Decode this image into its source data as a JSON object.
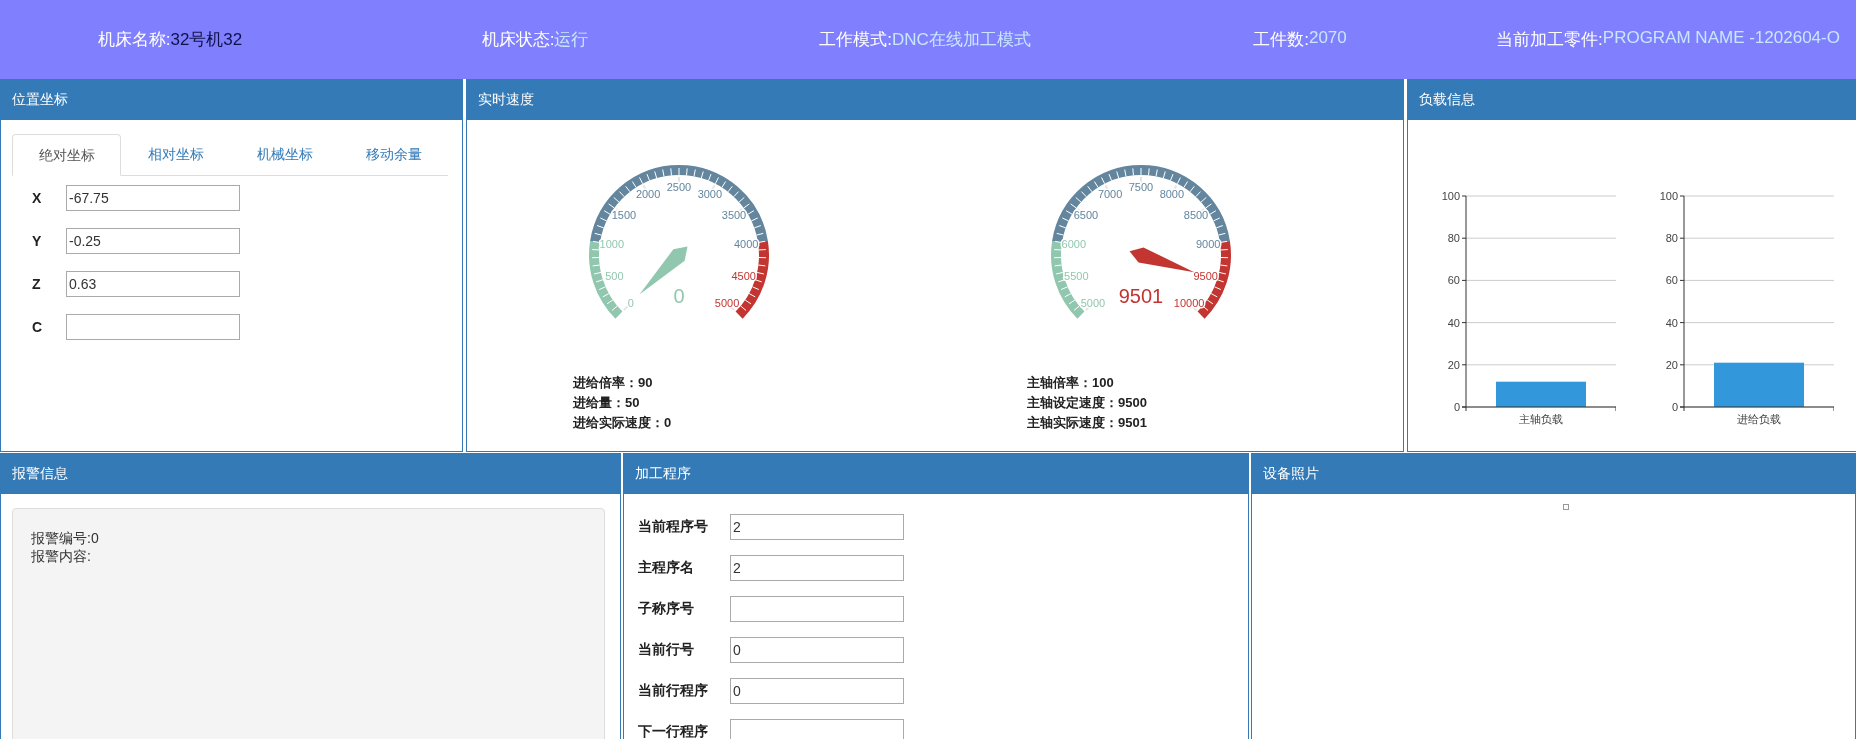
{
  "header": [
    {
      "label": "机床名称:",
      "value": "32号机32",
      "color": "#10104a"
    },
    {
      "label": "机床状态:",
      "value": "运行",
      "color": "#c8e6ff"
    },
    {
      "label": "工作模式:",
      "value": "DNC在线加工模式",
      "color": "#c8e6ff"
    },
    {
      "label": "工件数:",
      "value": "2070",
      "color": "#c8e6ff"
    },
    {
      "label": "当前加工零件:",
      "value": "PROGRAM NAME -1202604-O",
      "color": "#c8e6ff"
    }
  ],
  "position": {
    "title": "位置坐标",
    "tabs": [
      {
        "label": "绝对坐标",
        "selected": true
      },
      {
        "label": "相对坐标",
        "selected": false
      },
      {
        "label": "机械坐标",
        "selected": false
      },
      {
        "label": "移动余量",
        "selected": false
      }
    ],
    "axes": [
      {
        "label": "X",
        "value": "-67.75"
      },
      {
        "label": "Y",
        "value": "-0.25"
      },
      {
        "label": "Z",
        "value": "0.63"
      },
      {
        "label": "C"
      }
    ]
  },
  "speed": {
    "title": "实时速度",
    "gauges": [
      {
        "reading": "0",
        "tick_labels": [
          "0",
          "500",
          "1000",
          "1500",
          "2000",
          "2500",
          "3000",
          "3500",
          "4000",
          "4500",
          "5000"
        ],
        "stats": [
          "进给倍率：90",
          "进给量：50",
          "进给实际速度：0"
        ]
      },
      {
        "reading": "9501",
        "tick_labels": [
          "5000",
          "5500",
          "6000",
          "6500",
          "7000",
          "7500",
          "8000",
          "8500",
          "9000",
          "9500",
          "10000"
        ],
        "stats": [
          "主轴倍率：100",
          "主轴设定速度：9500",
          "主轴实际速度：9501"
        ]
      }
    ]
  },
  "load": {
    "title": "负载信息",
    "charts": [
      {
        "chart_data": {
          "type": "bar",
          "categories": [
            "主轴负载"
          ],
          "values": [
            12
          ],
          "ylim": [
            0,
            100
          ],
          "yticks": [
            0,
            20,
            40,
            60,
            80,
            100
          ],
          "grid": true
        }
      },
      {
        "chart_data": {
          "type": "bar",
          "categories": [
            "进给负载"
          ],
          "values": [
            21
          ],
          "ylim": [
            0,
            100
          ],
          "yticks": [
            0,
            20,
            40,
            60,
            80,
            100
          ],
          "grid": true
        }
      }
    ]
  },
  "alarm": {
    "title": "报警信息",
    "lines": [
      "报警编号:0",
      "报警内容:"
    ]
  },
  "program": {
    "title": "加工程序",
    "fields": [
      {
        "label": "当前程序号",
        "value": "2"
      },
      {
        "label": "主程序名",
        "value": "2"
      },
      {
        "label": "子称序号"
      },
      {
        "label": "当前行号",
        "value": "0"
      },
      {
        "label": "当前行程序",
        "value": "0"
      },
      {
        "label": "下一行程序"
      }
    ]
  },
  "photo": {
    "title": "设备照片"
  }
}
